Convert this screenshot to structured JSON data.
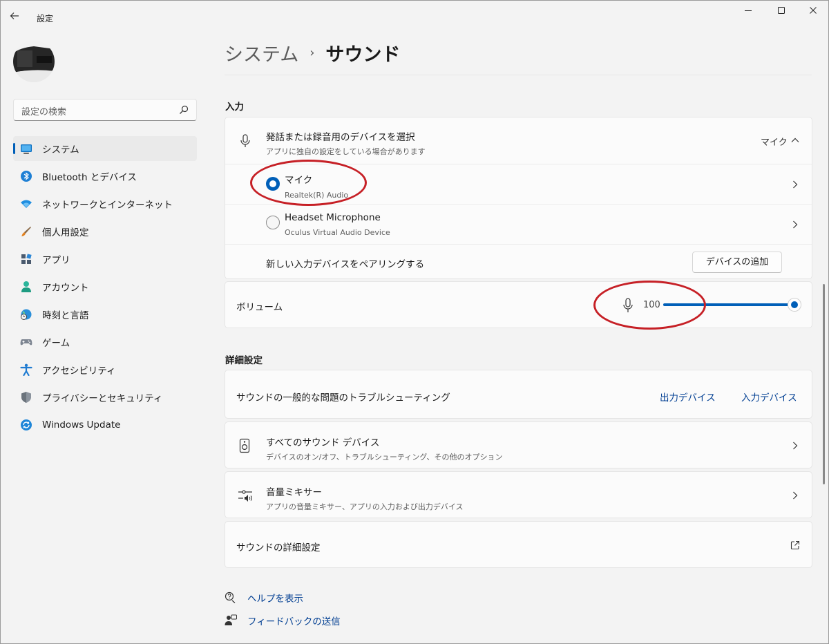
{
  "window": {
    "title": "設定",
    "back_icon": "back-arrow-icon",
    "controls": [
      "minimize",
      "maximize",
      "close"
    ]
  },
  "sidebar": {
    "search": {
      "placeholder": "設定の検索"
    },
    "items": [
      {
        "label": "システム",
        "icon": "display-icon",
        "active": true
      },
      {
        "label": "Bluetooth とデバイス",
        "icon": "bluetooth-icon"
      },
      {
        "label": "ネットワークとインターネット",
        "icon": "wifi-icon"
      },
      {
        "label": "個人用設定",
        "icon": "brush-icon"
      },
      {
        "label": "アプリ",
        "icon": "apps-icon"
      },
      {
        "label": "アカウント",
        "icon": "account-icon"
      },
      {
        "label": "時刻と言語",
        "icon": "globe-clock-icon"
      },
      {
        "label": "ゲーム",
        "icon": "gamepad-icon"
      },
      {
        "label": "アクセシビリティ",
        "icon": "accessibility-icon"
      },
      {
        "label": "プライバシーとセキュリティ",
        "icon": "shield-icon"
      },
      {
        "label": "Windows Update",
        "icon": "update-icon"
      }
    ]
  },
  "breadcrumb": {
    "parent": "システム",
    "separator": "›",
    "current": "サウンド"
  },
  "input_section": {
    "title": "入力",
    "device_select": {
      "title": "発話または録音用のデバイスを選択",
      "subtitle": "アプリに独自の設定をしている場合があります",
      "value": "マイク",
      "expanded": true
    },
    "devices": [
      {
        "name": "マイク",
        "detail": "Realtek(R) Audio",
        "selected": true
      },
      {
        "name": "Headset Microphone",
        "detail": "Oculus Virtual Audio Device",
        "selected": false
      }
    ],
    "pair": {
      "label": "新しい入力デバイスをペアリングする",
      "button": "デバイスの追加"
    },
    "volume": {
      "label": "ボリューム",
      "value": "100",
      "level": 1.0
    }
  },
  "advanced_section": {
    "title": "詳細設定",
    "troubleshoot": {
      "label": "サウンドの一般的な問題のトラブルシューティング",
      "output_link": "出力デバイス",
      "input_link": "入力デバイス"
    },
    "all_devices": {
      "title": "すべてのサウンド デバイス",
      "subtitle": "デバイスのオン/オフ、トラブルシューティング、その他のオプション",
      "icon": "speaker-icon"
    },
    "mixer": {
      "title": "音量ミキサー",
      "subtitle": "アプリの音量ミキサー、アプリの入力および出力デバイス",
      "icon": "mixer-icon"
    },
    "more": {
      "label": "サウンドの詳細設定",
      "icon": "open-external-icon"
    }
  },
  "footer": {
    "help": "ヘルプを表示",
    "feedback": "フィードバックの送信"
  },
  "colors": {
    "accent": "#005fb8",
    "annotation": "#c62026",
    "background": "#f3f3f3",
    "card": "#fbfbfb"
  }
}
